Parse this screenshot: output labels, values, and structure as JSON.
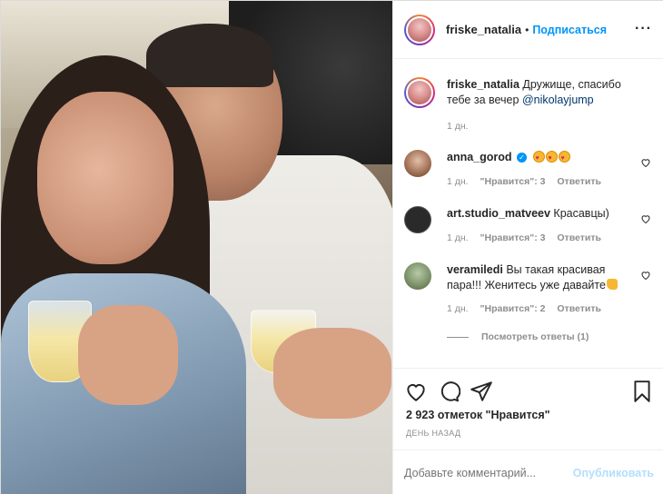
{
  "header": {
    "username": "friske_natalia",
    "dot": "•",
    "follow_label": "Подписаться",
    "more_icon": "more-horizontal-icon"
  },
  "caption": {
    "username": "friske_natalia",
    "text": "Дружище, спасибо тебе за вечер",
    "mention": "@nikolayjump",
    "time": "1 дн."
  },
  "comments": [
    {
      "username": "anna_gorod",
      "verified": true,
      "text": "",
      "emoji": [
        "heart-eyes-emoji",
        "heart-eyes-emoji",
        "heart-eyes-emoji"
      ],
      "time": "1 дн.",
      "likes": "\"Нравится\": 3",
      "reply_label": "Ответить"
    },
    {
      "username": "art.studio_matveev",
      "verified": false,
      "text": "Красавцы)",
      "time": "1 дн.",
      "likes": "\"Нравится\": 3",
      "reply_label": "Ответить"
    },
    {
      "username": "veramiledi",
      "verified": false,
      "text": "Вы такая красивая пара!!! Женитесь уже давайте",
      "emoji": [
        "thumbs-up-emoji"
      ],
      "time": "1 дн.",
      "likes": "\"Нравится\": 2",
      "reply_label": "Ответить"
    }
  ],
  "view_replies": "Посмотреть ответы (1)",
  "actions": {
    "icons": [
      "heart-icon",
      "comment-icon",
      "share-icon",
      "bookmark-icon"
    ],
    "likes_text": "2 923 отметок \"Нравится\"",
    "date_text": "ДЕНЬ НАЗАД"
  },
  "add_comment": {
    "placeholder": "Добавьте комментарий...",
    "post_label": "Опубликовать"
  },
  "colors": {
    "link_blue": "#0095f6",
    "mention": "#00376b",
    "muted": "#8e8e8e",
    "post_disabled": "#b2dffc"
  }
}
